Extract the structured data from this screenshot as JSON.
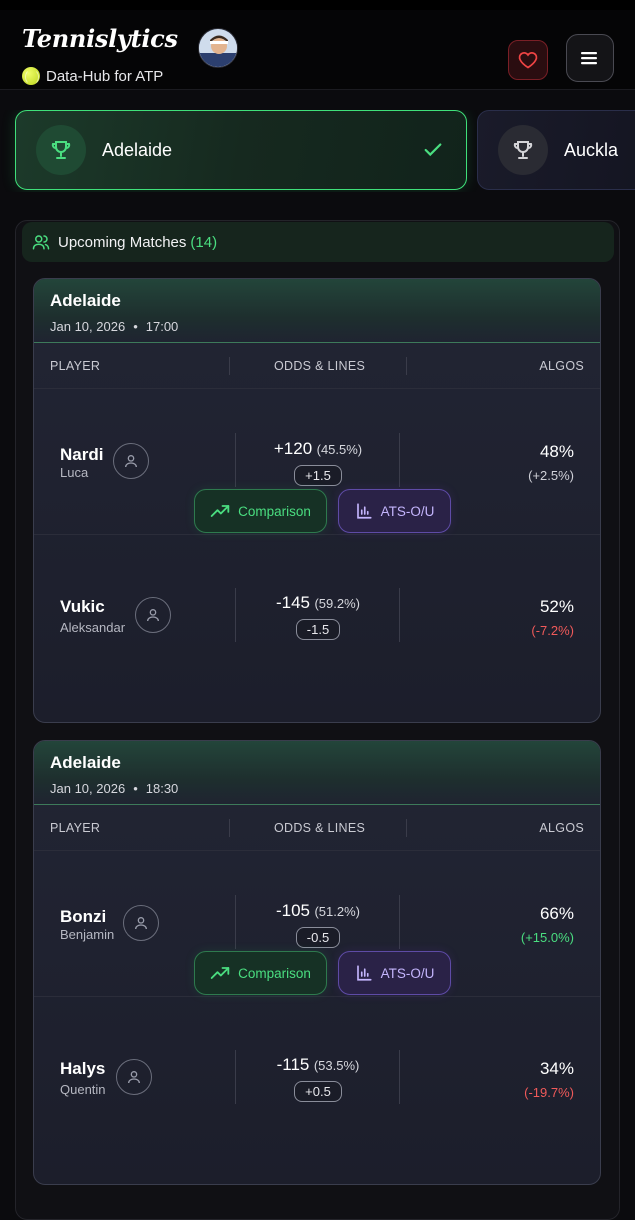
{
  "header": {
    "brand": "Tennislytics",
    "subtitle": "Data-Hub for ATP"
  },
  "tournaments": [
    {
      "name": "Adelaide",
      "selected": true
    },
    {
      "name": "Auckla",
      "selected": false
    }
  ],
  "upcoming": {
    "label": "Upcoming Matches",
    "count": "(14)"
  },
  "columns": {
    "player": "PLAYER",
    "odds": "ODDS & LINES",
    "algos": "ALGOS"
  },
  "buttons": {
    "comparison": "Comparison",
    "ats": "ATS-O/U"
  },
  "matches": [
    {
      "venue": "Adelaide",
      "date": "Jan 10, 2026",
      "time": "17:00",
      "players": [
        {
          "last": "Nardi",
          "first": "Luca",
          "odds": "+120",
          "odds_pct": "(45.5%)",
          "line": "+1.5",
          "algo": "48%",
          "change": "(+2.5%)"
        },
        {
          "last": "Vukic",
          "first": "Aleksandar",
          "odds": "-145",
          "odds_pct": "(59.2%)",
          "line": "-1.5",
          "algo": "52%",
          "change": "(-7.2%)"
        }
      ]
    },
    {
      "venue": "Adelaide",
      "date": "Jan 10, 2026",
      "time": "18:30",
      "players": [
        {
          "last": "Bonzi",
          "first": "Benjamin",
          "odds": "-105",
          "odds_pct": "(51.2%)",
          "line": "-0.5",
          "algo": "66%",
          "change": "(+15.0%)"
        },
        {
          "last": "Halys",
          "first": "Quentin",
          "odds": "-115",
          "odds_pct": "(53.5%)",
          "line": "+0.5",
          "algo": "34%",
          "change": "(-19.7%)"
        }
      ]
    }
  ],
  "colors": {
    "accent_green": "#4ade80",
    "accent_red": "#f05a5a",
    "accent_purple": "#c4b5fd"
  },
  "icons": [
    "trophy-icon",
    "check-icon",
    "heart-icon",
    "menu-icon",
    "users-icon",
    "user-icon",
    "trending-up-icon",
    "bar-chart-icon"
  ]
}
